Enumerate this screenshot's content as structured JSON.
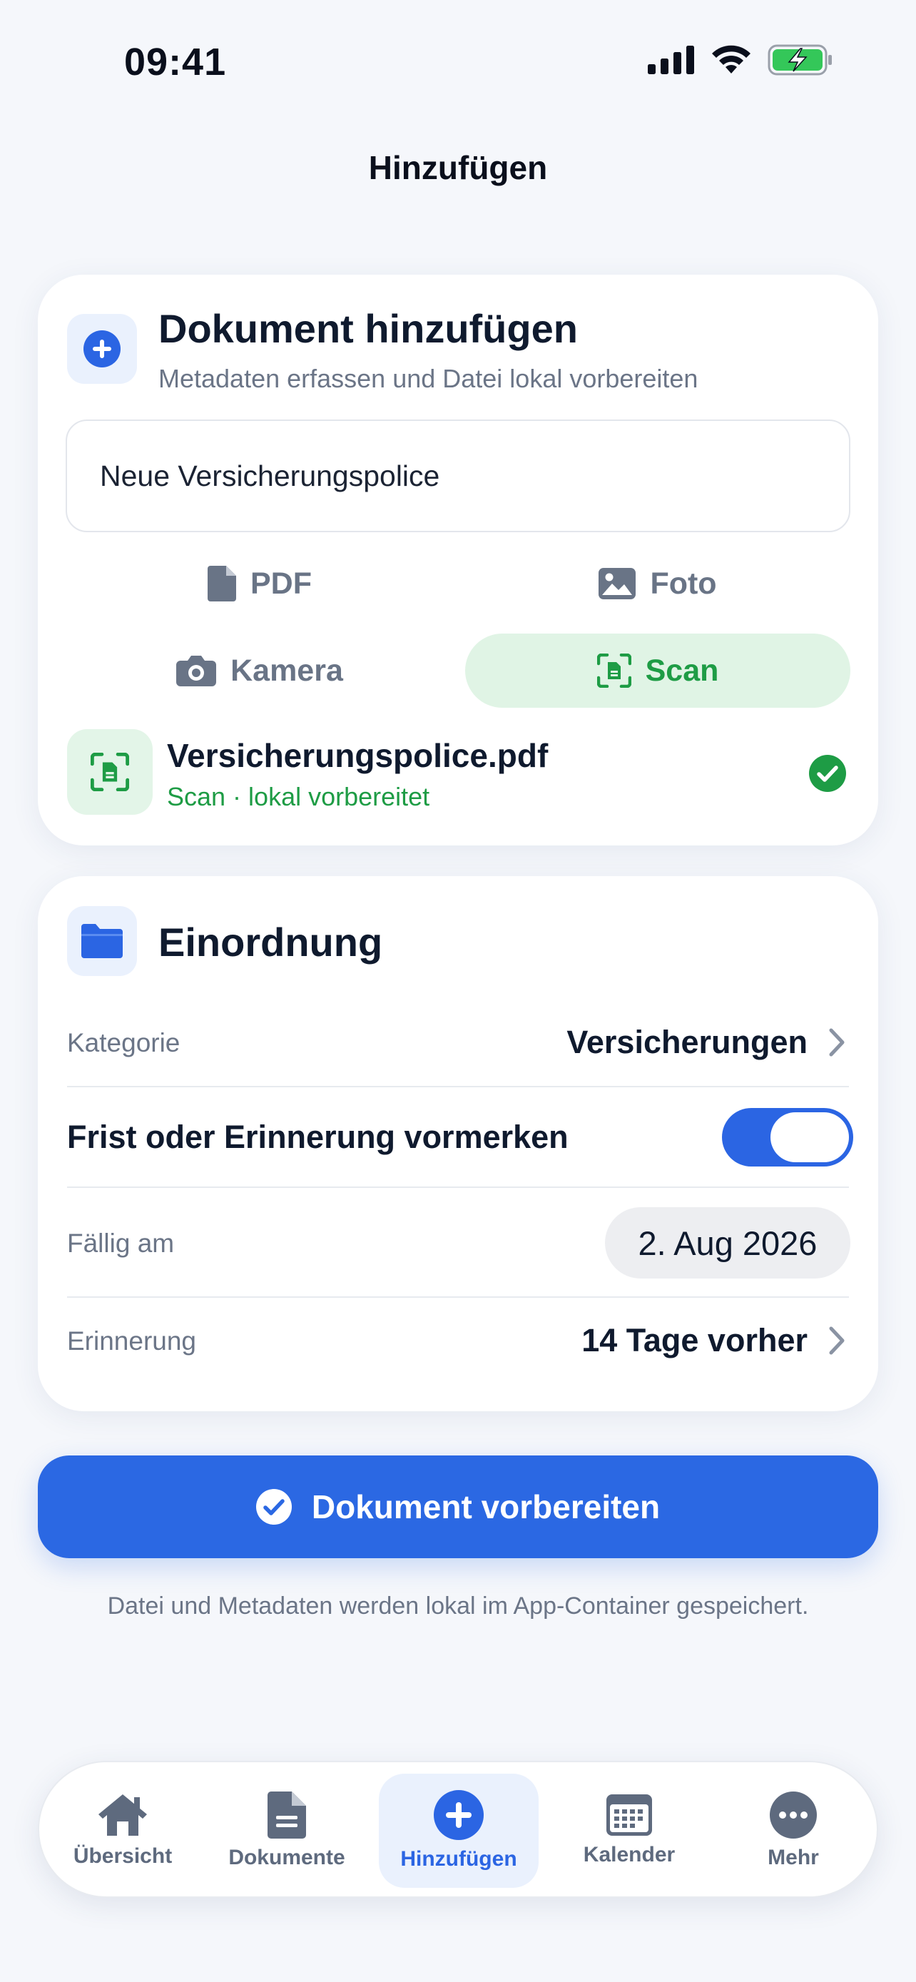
{
  "status_bar": {
    "time": "09:41"
  },
  "nav": {
    "title": "Hinzufügen"
  },
  "add_card": {
    "title": "Dokument hinzufügen",
    "subtitle": "Metadaten erfassen und Datei lokal vorbereiten",
    "name_input": {
      "value": "Neue Versicherungspolice"
    },
    "sources": [
      {
        "label": "PDF",
        "icon": "pdf-file-icon",
        "selected": false
      },
      {
        "label": "Foto",
        "icon": "photo-icon",
        "selected": false
      },
      {
        "label": "Kamera",
        "icon": "camera-icon",
        "selected": false
      },
      {
        "label": "Scan",
        "icon": "scan-icon",
        "selected": true
      }
    ],
    "file": {
      "name": "Versicherungspolice.pdf",
      "status": "Scan · lokal vorbereitet"
    }
  },
  "classify_card": {
    "title": "Einordnung",
    "category_label": "Kategorie",
    "category_value": "Versicherungen",
    "deadline_toggle_label": "Frist oder Erinnerung vormerken",
    "deadline_toggle_on": true,
    "due_label": "Fällig am",
    "due_value": "2. Aug 2026",
    "reminder_label": "Erinnerung",
    "reminder_value": "14 Tage vorher"
  },
  "primary_button": {
    "label": "Dokument vorbereiten"
  },
  "footnote": "Datei und Metadaten werden lokal im App-Container gespeichert.",
  "tabbar": {
    "tabs": [
      {
        "label": "Übersicht",
        "icon": "home-icon",
        "active": false
      },
      {
        "label": "Dokumente",
        "icon": "document-icon",
        "active": false
      },
      {
        "label": "Hinzufügen",
        "icon": "plus-circle-icon",
        "active": true
      },
      {
        "label": "Kalender",
        "icon": "calendar-icon",
        "active": false
      },
      {
        "label": "Mehr",
        "icon": "more-icon",
        "active": false
      }
    ]
  },
  "colors": {
    "accent": "#2B65E3",
    "success": "#1E9C45",
    "background": "#F5F7FB"
  }
}
